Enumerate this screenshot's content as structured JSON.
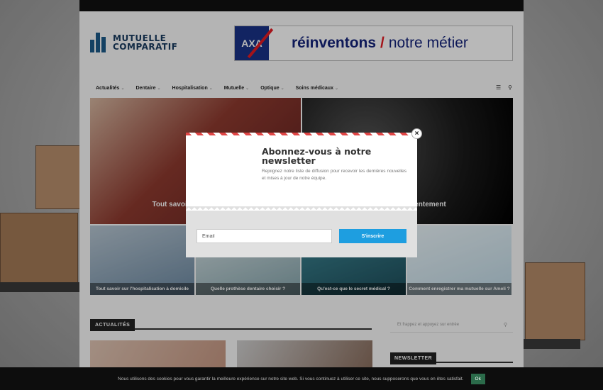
{
  "brand": {
    "logo_line1": "MUTUELLE",
    "logo_line2": "COMPARATIF"
  },
  "banner": {
    "logo": "AXA",
    "text_bold": "réinventons",
    "slash": "/",
    "text_rest": "notre métier"
  },
  "nav": {
    "items": [
      {
        "label": "Actualités"
      },
      {
        "label": "Dentaire"
      },
      {
        "label": "Hospitalisation"
      },
      {
        "label": "Mutuelle"
      },
      {
        "label": "Optique"
      },
      {
        "label": "Soins médicaux"
      }
    ],
    "caret": "⌄",
    "menu_icon": "hamburger-icon",
    "search_icon": "search-icon"
  },
  "featured": {
    "big_left": "Tout savoir sur le rembou",
    "big_right": "on sans consentement",
    "small": [
      "Tout savoir sur l'hospitalisation à domicile",
      "Quelle prothèse dentaire choisir ?",
      "Qu'est-ce que le secret médical ?",
      "Comment enregistrer ma mutuelle sur Ameli ?"
    ]
  },
  "sections": {
    "actualites": "ACTUALITÉS",
    "search_placeholder": "Et frappez et appuyez sur entrée",
    "newsletter": "NEWSLETTER"
  },
  "popup": {
    "title": "Abonnez-vous à notre newsletter",
    "text": "Rejoignez notre liste de diffusion pour recevoir les dernières nouvelles et mises à jour de notre équipe.",
    "email_placeholder": "Email",
    "subscribe_label": "S'inscrire",
    "close": "×"
  },
  "cookie": {
    "text": "Nous utilisons des cookies pour vous garantir la meilleure expérience sur notre site web. Si vous continuez à utiliser ce site, nous supposerons que vous en êtes satisfait.",
    "ok": "Ok"
  }
}
